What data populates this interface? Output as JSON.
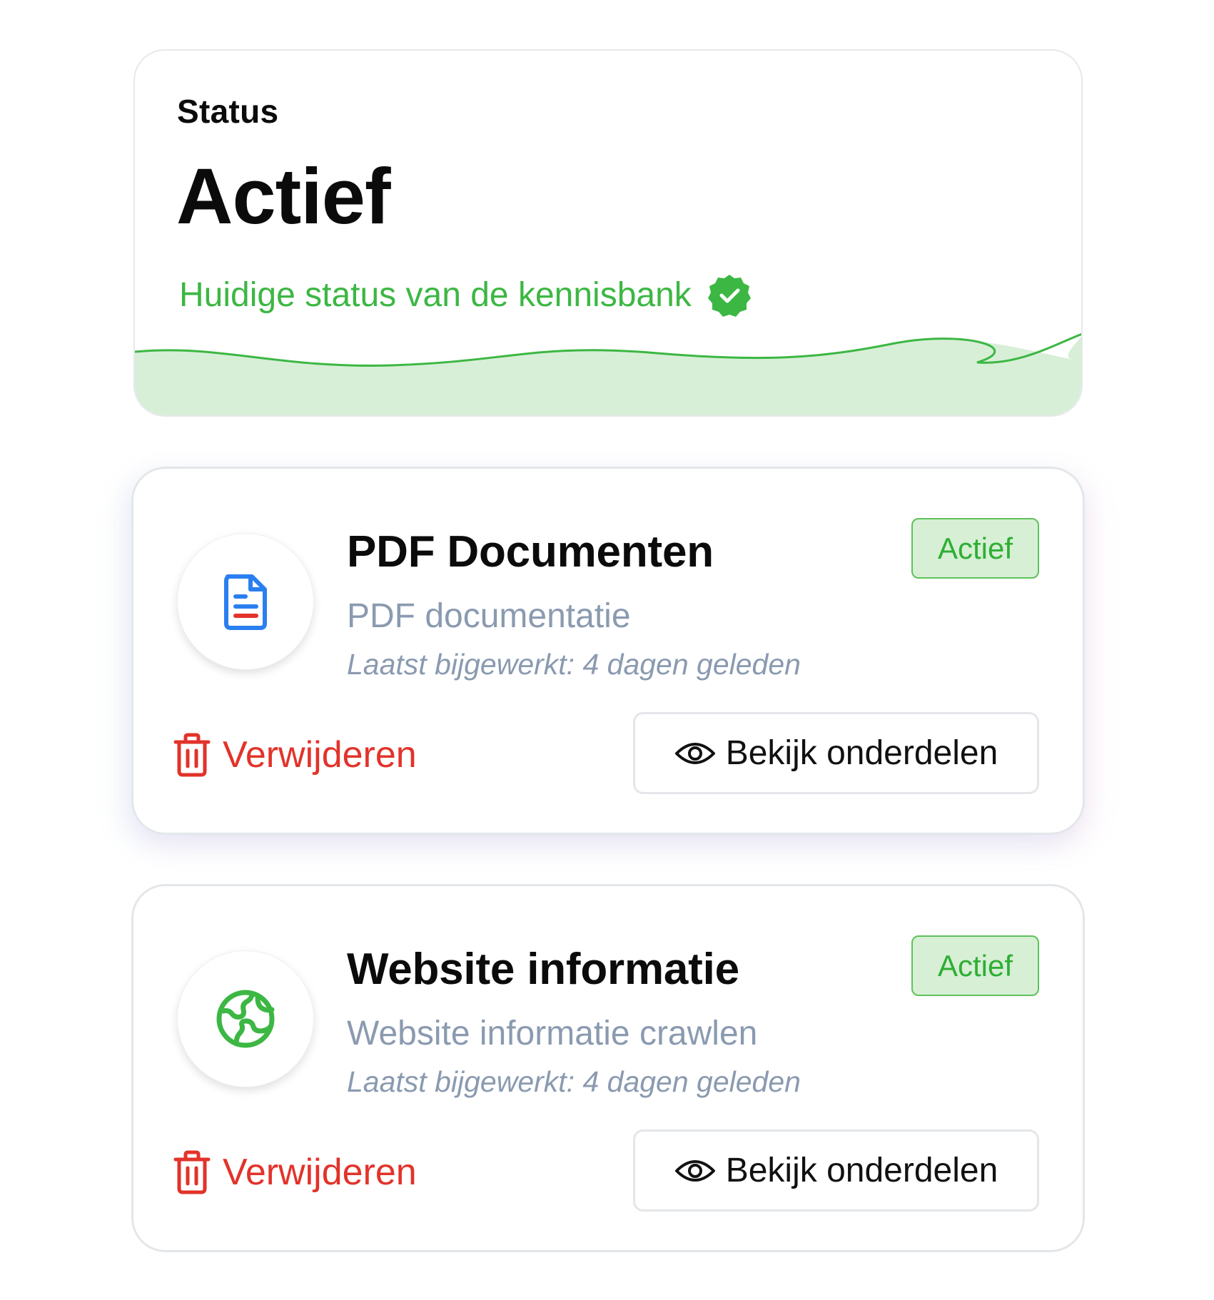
{
  "status_card": {
    "label": "Status",
    "value": "Actief",
    "subtitle": "Huidige status van de kennisbank",
    "accent_color": "#3cb743",
    "wave_fill": "#d8efd7",
    "verified_icon": "verified-check-icon"
  },
  "sources": [
    {
      "title": "PDF Documenten",
      "description": "PDF documentatie",
      "updated": "Laatst bijgewerkt: 4 dagen geleden",
      "badge": "Actief",
      "icon": "pdf-document-icon",
      "delete_label": "Verwijderen",
      "view_label": "Bekijk onderdelen"
    },
    {
      "title": "Website informatie",
      "description": "Website informatie crawlen",
      "updated": "Laatst bijgewerkt: 4 dagen geleden",
      "badge": "Actief",
      "icon": "globe-icon",
      "delete_label": "Verwijderen",
      "view_label": "Bekijk onderdelen"
    }
  ],
  "colors": {
    "danger": "#e2332a",
    "muted_text": "#8a9ab0",
    "badge_bg": "#d6efd5",
    "badge_border": "#5fc25a",
    "badge_text": "#2fae34",
    "doc_blue": "#2a7ff0"
  }
}
